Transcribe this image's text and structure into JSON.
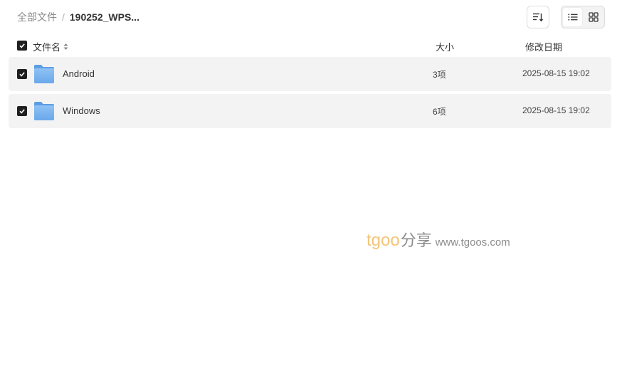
{
  "breadcrumb": {
    "root": "全部文件",
    "separator": "/",
    "current": "190252_WPS..."
  },
  "toolbar": {
    "sort_icon": "sort-icon",
    "list_view_icon": "list-view-icon",
    "grid_view_icon": "grid-view-icon",
    "active_view": "list"
  },
  "table": {
    "header": {
      "select_all_checked": true,
      "name": "文件名",
      "size": "大小",
      "date": "修改日期"
    },
    "rows": [
      {
        "checked": true,
        "icon": "folder-icon",
        "name": "Android",
        "size": "3项",
        "modified": "2025-08-15 19:02"
      },
      {
        "checked": true,
        "icon": "folder-icon",
        "name": "Windows",
        "size": "6项",
        "modified": "2025-08-15 19:02"
      }
    ]
  },
  "watermark": {
    "brand_latin": "tgoo",
    "brand_cjk": "分享",
    "url": "www.tgoos.com"
  },
  "colors": {
    "row_bg": "#f3f3f3",
    "checkbox": "#1f1f1f",
    "folder_blue": "#7fb6f0",
    "watermark_orange": "#f3c57a",
    "watermark_gray": "#8c8c8c"
  }
}
